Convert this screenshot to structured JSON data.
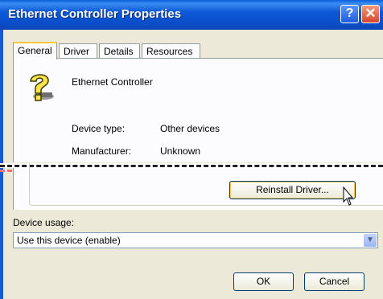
{
  "window": {
    "title": "Ethernet Controller Properties",
    "help_glyph": "?",
    "close_glyph": "✕"
  },
  "tabs": [
    {
      "label": "General",
      "active": true
    },
    {
      "label": "Driver"
    },
    {
      "label": "Details"
    },
    {
      "label": "Resources"
    }
  ],
  "device": {
    "icon": "unknown-device-question-icon",
    "name": "Ethernet Controller",
    "type_label": "Device type:",
    "type_value": "Other devices",
    "manufacturer_label": "Manufacturer:",
    "manufacturer_value": "Unknown"
  },
  "actions": {
    "reinstall_label": "Reinstall Driver..."
  },
  "usage": {
    "label": "Device usage:",
    "selected": "Use this device (enable)"
  },
  "footer": {
    "ok_label": "OK",
    "cancel_label": "Cancel"
  },
  "colors": {
    "titlebar": "#0a4fcc",
    "dialog_bg": "#ece9d8",
    "focus_ring": "#f5c85a"
  }
}
